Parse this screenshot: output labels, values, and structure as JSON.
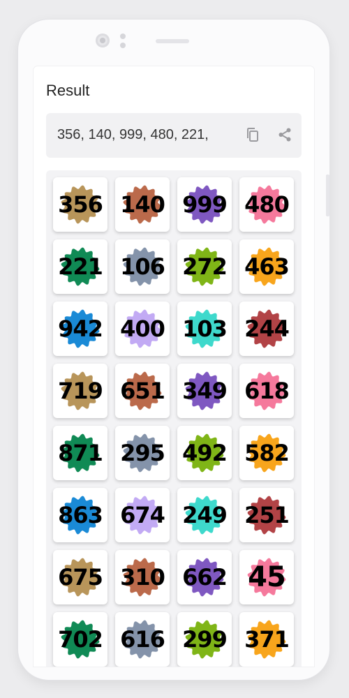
{
  "header": {
    "title": "Result"
  },
  "result": {
    "text": "356, 140, 999, 480, 221,",
    "copy_icon": "copy-icon",
    "share_icon": "share-icon"
  },
  "palette": [
    "#b8955a",
    "#bb6a4b",
    "#7f58c1",
    "#f5799c",
    "#108a55",
    "#8493aa",
    "#7fb517",
    "#f8a51c",
    "#1a8ad6",
    "#c2aaf4",
    "#3ed9cc",
    "#b24346"
  ],
  "numbers": [
    "356",
    "140",
    "999",
    "480",
    "221",
    "106",
    "272",
    "463",
    "942",
    "400",
    "103",
    "244",
    "719",
    "651",
    "349",
    "618",
    "871",
    "295",
    "492",
    "582",
    "863",
    "674",
    "249",
    "251",
    "675",
    "310",
    "662",
    "45",
    "702",
    "616",
    "299",
    "371"
  ]
}
